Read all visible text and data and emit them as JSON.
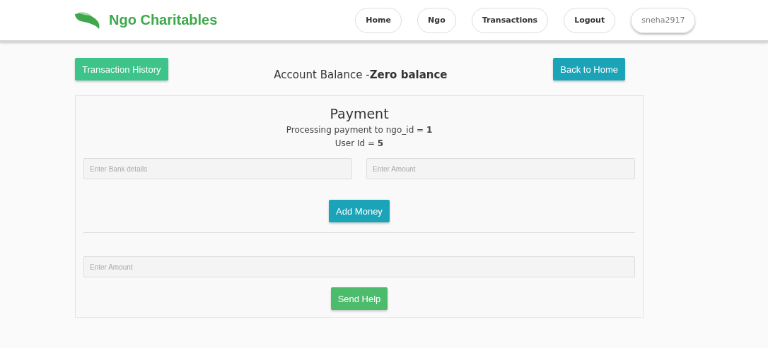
{
  "brand": {
    "name": "Ngo Charitables"
  },
  "nav": [
    {
      "label": "Home",
      "kind": "link"
    },
    {
      "label": "Ngo",
      "kind": "link"
    },
    {
      "label": "Transactions",
      "kind": "link"
    },
    {
      "label": "Logout",
      "kind": "link"
    },
    {
      "label": "sneha2917",
      "kind": "user"
    }
  ],
  "toolbar": {
    "history_button": "Transaction History",
    "balance": "Account Balance -**Zero balance**",
    "back_button": "Back to Home"
  },
  "payment": {
    "title": "Payment",
    "lines": [
      "Processing payment to ngo_id = **1**",
      "User Id = **5**"
    ],
    "bank_field": {
      "placeholder": "Enter Bank details"
    },
    "amount_field": {
      "placeholder": "Enter Amount"
    },
    "add_button": "Add Money",
    "help_field": {
      "placeholder": "Enter Amount"
    },
    "help_button": "Send Help"
  }
}
